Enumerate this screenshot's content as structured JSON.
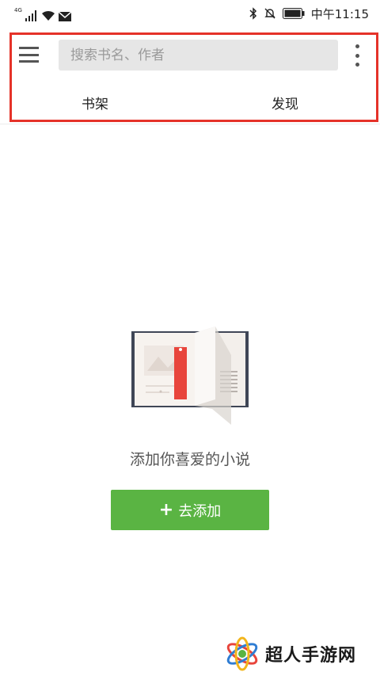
{
  "status_bar": {
    "network": "4G",
    "time": "中午11:15"
  },
  "toolbar": {
    "search_placeholder": "搜索书名、作者",
    "tabs": [
      {
        "label": "书架"
      },
      {
        "label": "发现"
      }
    ]
  },
  "empty_state": {
    "message": "添加你喜爱的小说",
    "add_button_plus": "+",
    "add_button_label": "去添加"
  },
  "watermark": {
    "text": "超人手游网"
  },
  "colors": {
    "accent_green": "#5ab443",
    "highlight_red": "#e53229",
    "bookmark_red": "#e8453c"
  }
}
